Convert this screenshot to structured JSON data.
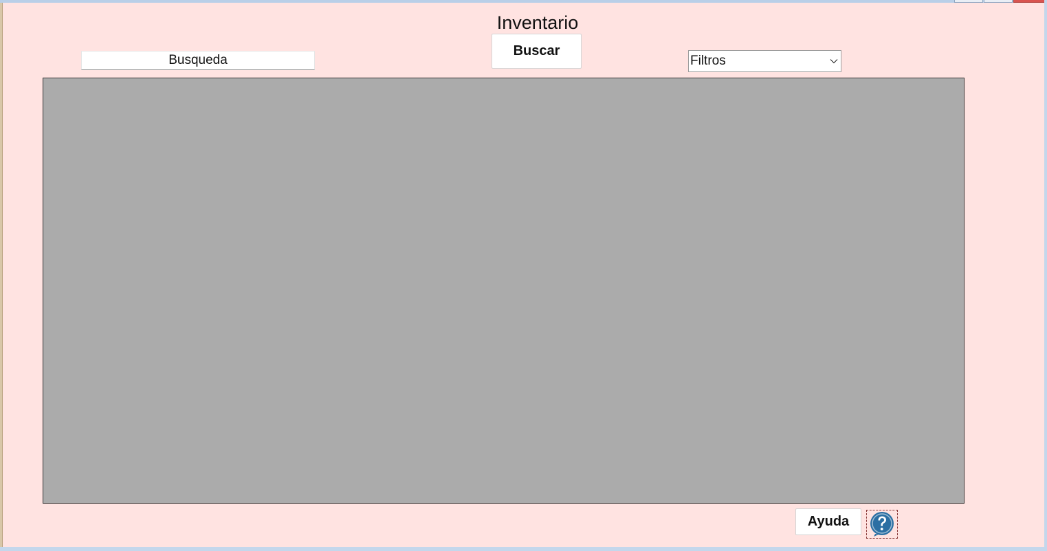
{
  "window": {
    "title": "Inventario"
  },
  "search": {
    "value": "Busqueda"
  },
  "buttons": {
    "search_label": "Buscar",
    "help_label": "Ayuda"
  },
  "filters": {
    "selected": "Filtros"
  },
  "grid": {
    "rows": []
  },
  "icons": {
    "help": "help-question-icon",
    "dropdown": "chevron-down-icon"
  },
  "colors": {
    "form_background": "#ffe3e1",
    "grid_background": "#ababab",
    "help_icon": "#2b6fa3"
  }
}
